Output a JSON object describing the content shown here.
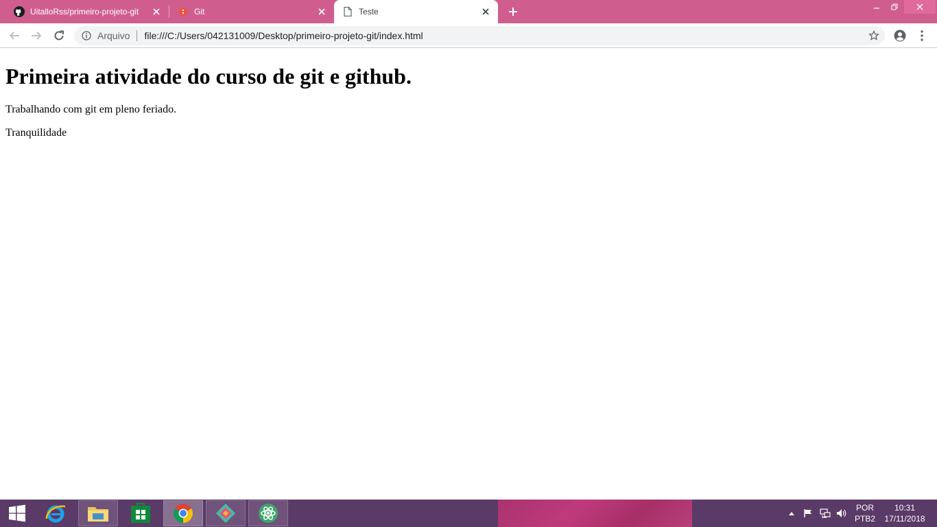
{
  "browser": {
    "tabs": [
      {
        "label": "UitalloRss/primeiro-projeto-git",
        "icon": "github-icon",
        "active": false
      },
      {
        "label": "Git",
        "icon": "git-icon",
        "active": false
      },
      {
        "label": "Teste",
        "icon": "page-icon",
        "active": true
      }
    ],
    "new_tab": "+",
    "window_controls": [
      "minimize",
      "restore",
      "close"
    ],
    "omnibox": {
      "origin": "Arquivo",
      "url": "file:///C:/Users/042131009/Desktop/primeiro-projeto-git/index.html"
    },
    "accent_color": "#cf5e8f"
  },
  "page": {
    "heading": "Primeira atividade do curso de git e github.",
    "paragraphs": [
      "Trabalhando com git em pleno feriado.",
      "Tranquilidade"
    ]
  },
  "taskbar": {
    "apps": [
      "start-icon",
      "internet-explorer-icon",
      "file-explorer-icon",
      "store-icon",
      "chrome-icon",
      "gitkraken-icon",
      "atom-icon"
    ],
    "language": {
      "line1": "POR",
      "line2": "PTB2"
    },
    "clock": {
      "time": "10:31",
      "date": "17/11/2018"
    },
    "color": "#5a3a67"
  }
}
